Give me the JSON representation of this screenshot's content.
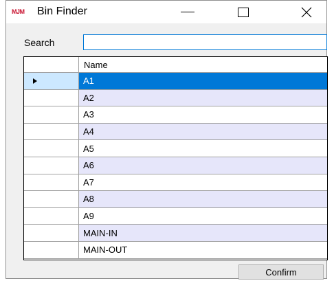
{
  "window": {
    "logo_text": "MJM",
    "title": "Bin Finder",
    "accent_color": "#0078d7",
    "logo_color": "#c8102e"
  },
  "search": {
    "label": "Search",
    "value": ""
  },
  "grid": {
    "column_header": "Name",
    "rows": [
      {
        "name": "A1"
      },
      {
        "name": "A2"
      },
      {
        "name": "A3"
      },
      {
        "name": "A4"
      },
      {
        "name": "A5"
      },
      {
        "name": "A6"
      },
      {
        "name": "A7"
      },
      {
        "name": "A8"
      },
      {
        "name": "A9"
      },
      {
        "name": "MAIN-IN"
      },
      {
        "name": "MAIN-OUT"
      }
    ],
    "selected_row": "A1",
    "alt_row_color": "#e6e6fa"
  },
  "actions": {
    "confirm_label": "Confirm"
  }
}
